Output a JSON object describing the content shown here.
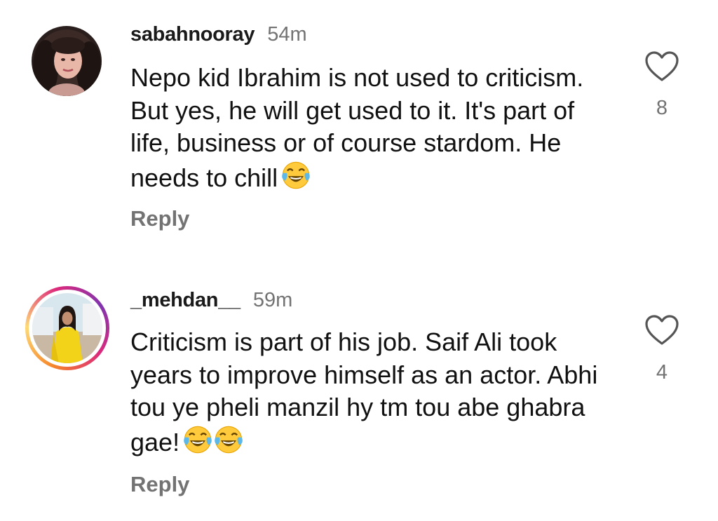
{
  "comments": [
    {
      "username": "sabahnooray",
      "time": "54m",
      "text": "Nepo kid Ibrahim is not used to criticism. But yes, he will get used to it. It's part of life, business or of course stardom. He needs to chill",
      "emoji_count": 1,
      "emoji_icon": "face-with-tears-of-joy-icon",
      "likes": "8",
      "reply_label": "Reply",
      "has_story_ring": false
    },
    {
      "username": "_mehdan__",
      "time": "59m",
      "text": "Criticism is part of his job. Saif Ali took years to improve himself as an actor. Abhi tou ye pheli manzil hy tm tou abe ghabra gae!",
      "emoji_count": 2,
      "emoji_icon": "face-with-tears-of-joy-icon",
      "likes": "4",
      "reply_label": "Reply",
      "has_story_ring": true
    }
  ],
  "colors": {
    "text": "#111111",
    "secondary": "#737373",
    "story_ring": [
      "#f58529",
      "#feda77",
      "#dd2a7b",
      "#8134af"
    ]
  }
}
